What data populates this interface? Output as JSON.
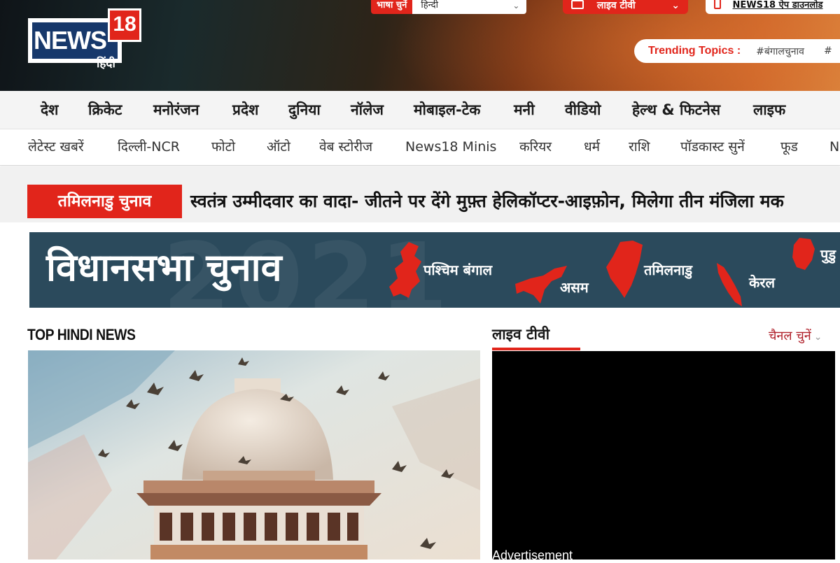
{
  "brand": {
    "name": "NEWS",
    "number": "18",
    "subtitle": "हिंदी"
  },
  "header": {
    "language_label": "भाषा चुनें",
    "language_value": "हिन्दी",
    "live_tv_label": "लाइव टीवी",
    "app_download_label": "NEWS18 ऐप डाउनलोड",
    "trending_label": "Trending Topics :",
    "trending_tags": [
      "#बंगालचुनाव",
      "#"
    ]
  },
  "primary_nav": [
    "देश",
    "क्रिकेट",
    "मनोरंजन",
    "प्रदेश",
    "दुनिया",
    "नॉलेज",
    "मोबाइल-टेक",
    "मनी",
    "वीडियो",
    "हेल्थ & फिटनेस",
    "लाइफ"
  ],
  "secondary_nav": [
    "लेटेस्ट खबरें",
    "दिल्ली-NCR",
    "फोटो",
    "ऑटो",
    "वेब स्टोरीज",
    "News18 Minis",
    "करियर",
    "धर्म",
    "राशि",
    "पॉडकास्ट सुनें",
    "फूड",
    "N"
  ],
  "breaking": {
    "tag": "तमिलनाडु चुनाव",
    "headline": "स्वतंत्र उम्मीदवार का वादा- जीतने पर देंगे मुफ़्त हेलिकॉप्टर-आइफ़ोन, मिलेगा तीन मंजिला मक"
  },
  "election_banner": {
    "title": "विधानसभा चुनाव",
    "year": "2021",
    "states": [
      "पश्चिम बंगाल",
      "असम",
      "तमिलनाडु",
      "केरल",
      "पुडु"
    ],
    "map_color": "#e1251b"
  },
  "top_news": {
    "title": "TOP HINDI NEWS"
  },
  "live_tv": {
    "title": "लाइव टीवी",
    "channel_select": "चैनल चुनें",
    "ad_label": "Advertisement"
  },
  "colors": {
    "accent": "#e1251b",
    "brand_blue": "#17386b",
    "banner_bg": "#2b4a5c"
  }
}
